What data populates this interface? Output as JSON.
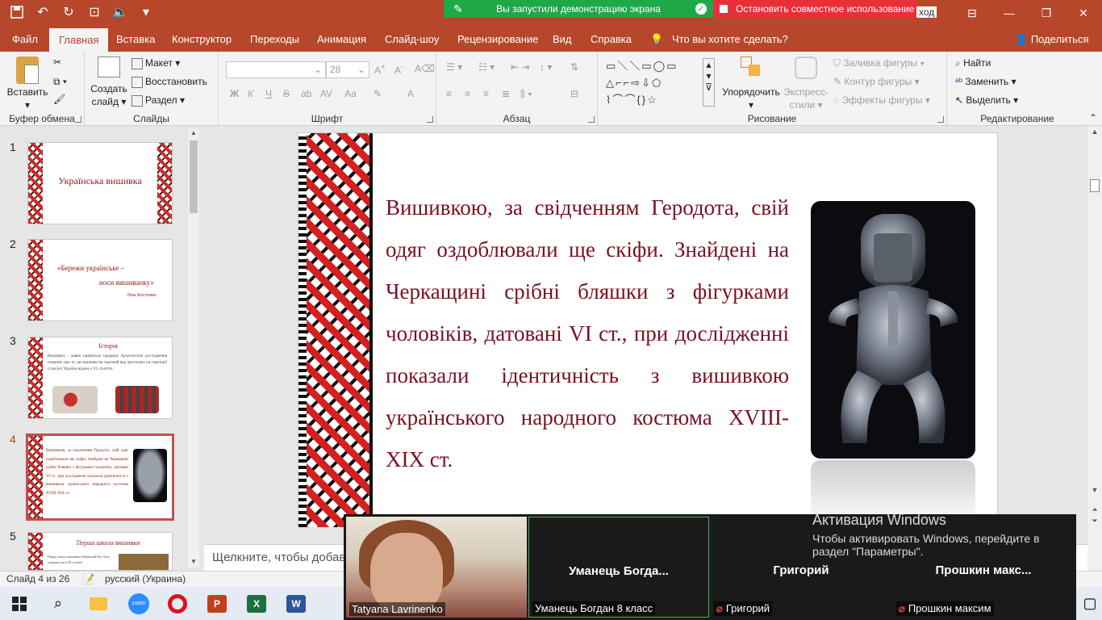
{
  "titlebar": {
    "share_banner": "Вы запустили демонстрацию экрана",
    "stop_banner": "Остановить совместное использование",
    "title_partial": "ход",
    "qat_icons": [
      "save-icon",
      "undo-icon",
      "redo-icon",
      "presentation-icon",
      "speaker-icon",
      "customize-icon"
    ]
  },
  "tabs": [
    "Файл",
    "Главная",
    "Вставка",
    "Конструктор",
    "Переходы",
    "Анимация",
    "Слайд-шоу",
    "Рецензирование",
    "Вид",
    "Справка",
    "Что вы хотите сделать?"
  ],
  "share_label": "Поделиться",
  "ribbon": {
    "clipboard": {
      "paste": "Вставить",
      "label": "Буфер обмена"
    },
    "slides": {
      "new": "Создать",
      "new2": "слайд",
      "layout": "Макет",
      "reset": "Восстановить",
      "section": "Раздел",
      "label": "Слайды"
    },
    "font": {
      "size": "28",
      "label": "Шрифт",
      "b": "Ж",
      "i": "К",
      "u": "Ч",
      "s": "S",
      "ab": "ab",
      "av": "AV",
      "aa": "Аа",
      "a": "А"
    },
    "paragraph": {
      "label": "Абзац"
    },
    "drawing": {
      "arrange": "Упорядочить",
      "styles": "Экспресс-",
      "styles2": "стили",
      "fill": "Заливка фигуры",
      "outline": "Контур фигуры",
      "effects": "Эффекты фигуры",
      "label": "Рисование"
    },
    "editing": {
      "find": "Найти",
      "replace": "Заменить",
      "select": "Выделить",
      "label": "Редактирование"
    }
  },
  "thumbs": [
    {
      "num": "1",
      "title": "Українська вишивка"
    },
    {
      "num": "2",
      "quote1": "«Бережи українське –",
      "quote2": "носи вишиванку»",
      "author": "Ліна Костенко"
    },
    {
      "num": "3",
      "title": "Історія",
      "body": "Вишивати – давня українська традиція. Археологічні дослідження говорять про те, що вишивка як окремий вид мистецтва на території сучасної України відома з VI століття."
    },
    {
      "num": "4",
      "body": "Вишивкою, за свідченням Геродота, свій одяг оздоблювали ще скіфи. Знайдені на Черкащині срібні бляшки з фігурками чоловіків, датовані VI ст., при дослідженні показали ідентичність з вишивкою українського народного костюма XVIII-XIX ст."
    },
    {
      "num": "5",
      "title": "Перша школа вишивки",
      "body": "Першу школу вишивки в Київській Русі було створено ще в XI столітті"
    }
  ],
  "slide": {
    "text": "Вишивкою, за свідченням Геродота, свій одяг оздоблювали ще скіфи. Знайдені на Черкащині срібні бляшки з фігурками чоловіків, датовані VI ст., при дослідженні показали ідентичність з вишивкою українського народного костюма XVIII-XIX ст."
  },
  "notes_placeholder": "Щелкните, чтобы добав",
  "status": {
    "slide": "Слайд 4 из 26",
    "lang": "русский (Украина)"
  },
  "zoom": {
    "tiles": [
      {
        "name": "",
        "label": "Tatyana Lavrinenko",
        "muted": false
      },
      {
        "name": "Уманець Богда...",
        "label": "Уманець Богдан 8 класс",
        "muted": false
      },
      {
        "name": "Григорий",
        "label": "Григорий",
        "muted": true
      },
      {
        "name": "Прошкин макс...",
        "label": "Прошкин максим",
        "muted": true
      }
    ]
  },
  "watermark": {
    "title": "Активация Windows",
    "line1": "Чтобы активировать Windows, перейдите в",
    "line2": "раздел \"Параметры\"."
  },
  "taskbar": [
    "windows-start-icon",
    "search-icon",
    "file-explorer-icon",
    "zoom-icon",
    "opera-icon",
    "powerpoint-icon",
    "excel-icon",
    "word-icon"
  ],
  "colors": {
    "accent": "#b7472a",
    "slide_text": "#7a1020",
    "share_green": "#1fa847",
    "stop_red": "#e8303a"
  }
}
